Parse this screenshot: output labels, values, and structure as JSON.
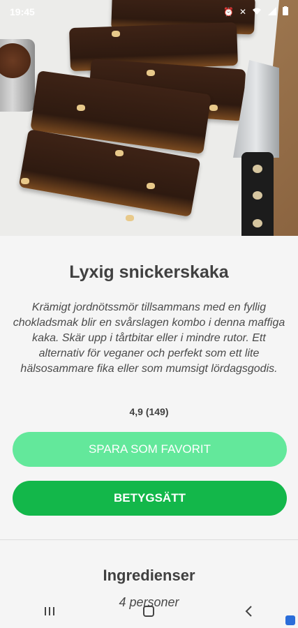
{
  "status": {
    "time": "19:45"
  },
  "recipe": {
    "title": "Lyxig snickerskaka",
    "description": "Krämigt jordnötssmör tillsammans med en fyllig chokladsmak blir en svårslagen kombo i denna maffiga kaka. Skär upp i tårtbitar eller i mindre rutor. Ett alternativ för veganer och perfekt som ett lite hälsosammare fika eller som mumsigt lördagsgodis.",
    "rating": "4,9 (149)"
  },
  "actions": {
    "favorite_label": "SPARA SOM FAVORIT",
    "rate_label": "BETYGSÄTT"
  },
  "ingredients": {
    "title": "Ingredienser",
    "servings": "4 personer"
  },
  "colors": {
    "favorite_button": "#63e89b",
    "rate_button": "#13b74a"
  },
  "icons": {
    "nav_recent": "recent-apps-icon",
    "nav_home": "home-icon",
    "nav_back": "back-icon"
  }
}
